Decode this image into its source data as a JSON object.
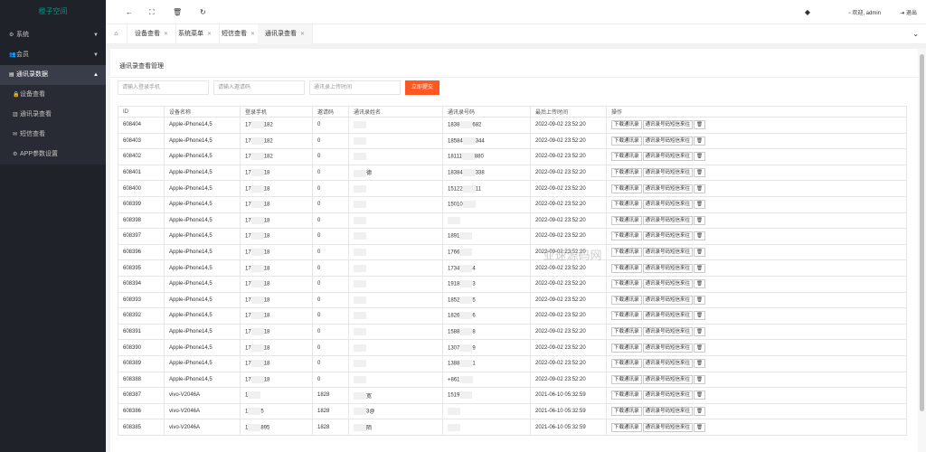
{
  "app": {
    "logo": "橙子空间"
  },
  "sidebar": {
    "items": [
      {
        "label": "系统",
        "icon": "gear-icon"
      },
      {
        "label": "会员",
        "icon": "users-icon"
      },
      {
        "label": "通讯录数据",
        "icon": "card-icon"
      }
    ],
    "sub_items": [
      {
        "label": "设备查看",
        "icon": "lock-icon"
      },
      {
        "label": "通讯录查看",
        "icon": "book-icon"
      },
      {
        "label": "短信查看",
        "icon": "mail-icon"
      },
      {
        "label": "APP参数设置",
        "icon": "gear-icon"
      }
    ],
    "tooltip": "设备查看"
  },
  "topbar": {
    "user": "欢迎, admin",
    "logout": "退出"
  },
  "tabs": [
    {
      "label": "设备查看"
    },
    {
      "label": "系统菜单"
    },
    {
      "label": "短信查看"
    },
    {
      "label": "通讯录查看"
    }
  ],
  "panel": {
    "title": "通讯录查看管理",
    "search_phone_placeholder": "请输入登录手机",
    "search_invite_placeholder": "请输入邀请码",
    "search_time_placeholder": "通讯录上传时间",
    "submit_label": "立即提交"
  },
  "table": {
    "headers": [
      "ID",
      "设备名称",
      "登录手机",
      "邀请码",
      "通讯录姓名",
      "通讯录号码",
      "最后上传时间",
      "操作"
    ],
    "actions": [
      "下载通讯录",
      "通讯录号码短信来往",
      "🗑"
    ],
    "rows": [
      [
        "608404",
        "Apple-iPhone14,5",
        "17",
        "182",
        "0",
        "",
        "1838",
        "682",
        "2022-09-02 23:52:20"
      ],
      [
        "608403",
        "Apple-iPhone14,5",
        "17",
        "182",
        "0",
        "",
        "18584",
        "344",
        "2022-09-02 23:52:20"
      ],
      [
        "608402",
        "Apple-iPhone14,5",
        "17",
        "182",
        "0",
        "",
        "18111",
        "880",
        "2022-09-02 23:52:20"
      ],
      [
        "608401",
        "Apple-iPhone14,5",
        "17",
        "18",
        "0",
        "德",
        "18384",
        "338",
        "2022-09-02 23:52:20"
      ],
      [
        "608400",
        "Apple-iPhone14,5",
        "17",
        "18",
        "0",
        "",
        "15122",
        "11",
        "2022-09-02 23:52:20"
      ],
      [
        "608399",
        "Apple-iPhone14,5",
        "17",
        "18",
        "0",
        "",
        "15010",
        "",
        "2022-09-02 23:52:20"
      ],
      [
        "608398",
        "Apple-iPhone14,5",
        "17",
        "18",
        "0",
        "",
        "",
        "",
        "2022-09-02 23:52:20"
      ],
      [
        "608397",
        "Apple-iPhone14,5",
        "17",
        "18",
        "0",
        "",
        "1891",
        "",
        "2022-09-02 23:52:20"
      ],
      [
        "608396",
        "Apple-iPhone14,5",
        "17",
        "18",
        "0",
        "",
        "1766",
        "",
        "2022-09-02 23:52:20"
      ],
      [
        "608395",
        "Apple-iPhone14,5",
        "17",
        "18",
        "0",
        "",
        "1734",
        "4",
        "2022-09-02 23:52:20"
      ],
      [
        "608394",
        "Apple-iPhone14,5",
        "17",
        "18",
        "0",
        "",
        "1918",
        "3",
        "2022-09-02 23:52:20"
      ],
      [
        "608393",
        "Apple-iPhone14,5",
        "17",
        "18",
        "0",
        "",
        "1852",
        "5",
        "2022-09-02 23:52:20"
      ],
      [
        "608392",
        "Apple-iPhone14,5",
        "17",
        "18",
        "0",
        "",
        "1826",
        "6",
        "2022-09-02 23:52:20"
      ],
      [
        "608391",
        "Apple-iPhone14,5",
        "17",
        "18",
        "0",
        "",
        "1588",
        "8",
        "2022-09-02 23:52:20"
      ],
      [
        "608390",
        "Apple-iPhone14,5",
        "17",
        "18",
        "0",
        "",
        "1307",
        "9",
        "2022-09-02 23:52:20"
      ],
      [
        "608389",
        "Apple-iPhone14,5",
        "17",
        "18",
        "0",
        "",
        "1388",
        "1",
        "2022-09-02 23:52:20"
      ],
      [
        "608388",
        "Apple-iPhone14,5",
        "17",
        "18",
        "0",
        "",
        "+861",
        "",
        "2022-09-02 23:52:20"
      ],
      [
        "608387",
        "vivo-V2046A",
        "1",
        "",
        "1828",
        "宽",
        "1519",
        "",
        "2021-06-10 05:32:59"
      ],
      [
        "608386",
        "vivo-V2046A",
        "1",
        "5",
        "1828",
        "3@",
        "",
        "",
        "2021-06-10 05:32:59"
      ],
      [
        "608385",
        "vivo-V2046A",
        "1",
        "895",
        "1828",
        "陌",
        "",
        "",
        "2021-06-10 05:32:59"
      ]
    ]
  },
  "watermark": "亚速源码网"
}
